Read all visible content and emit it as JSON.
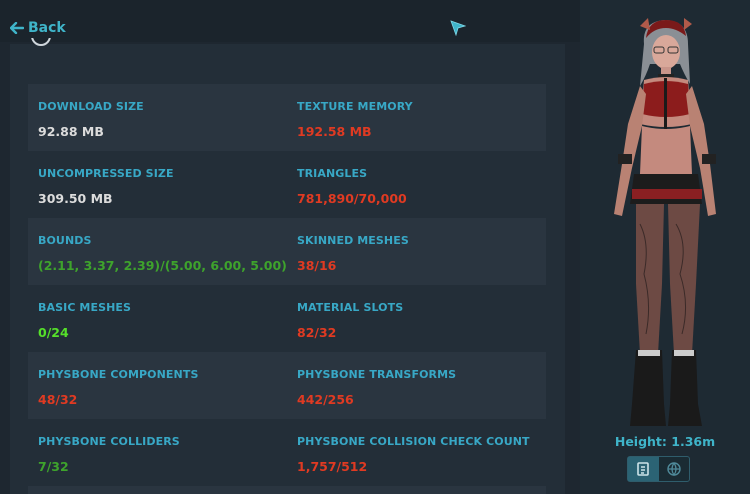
{
  "nav": {
    "back_label": "Back"
  },
  "stats": [
    {
      "label": "DOWNLOAD SIZE",
      "value": "92.88 MB",
      "color": "#dcdcdc"
    },
    {
      "label": "TEXTURE MEMORY",
      "value": "192.58 MB",
      "color": "#e03a22"
    },
    {
      "label": "UNCOMPRESSED SIZE",
      "value": "309.50 MB",
      "color": "#dcdcdc"
    },
    {
      "label": "TRIANGLES",
      "value": "781,890/70,000",
      "color": "#e03a22"
    },
    {
      "label": "BOUNDS",
      "value": "(2.11, 3.37, 2.39)/(5.00, 6.00, 5.00)",
      "color": "#3ea32c"
    },
    {
      "label": "SKINNED MESHES",
      "value": "38/16",
      "color": "#e03a22"
    },
    {
      "label": "BASIC MESHES",
      "value": "0/24",
      "color": "#55e02a"
    },
    {
      "label": "MATERIAL SLOTS",
      "value": "82/32",
      "color": "#e03a22"
    },
    {
      "label": "PHYSBONE COMPONENTS",
      "value": "48/32",
      "color": "#e03a22"
    },
    {
      "label": "PHYSBONE TRANSFORMS",
      "value": "442/256",
      "color": "#e03a22"
    },
    {
      "label": "PHYSBONE COLLIDERS",
      "value": "7/32",
      "color": "#3ea32c"
    },
    {
      "label": "PHYSBONE COLLISION CHECK COUNT",
      "value": "1,757/512",
      "color": "#e03a22"
    }
  ],
  "avatar_panel": {
    "height_label": "Height: 1.36m"
  },
  "icons": {
    "back": "arrow-left-icon",
    "cursor": "pointer-cursor-icon",
    "spinner": "loading-spinner-icon",
    "view_a": "avatar-details-icon",
    "view_b": "globe-icon"
  }
}
